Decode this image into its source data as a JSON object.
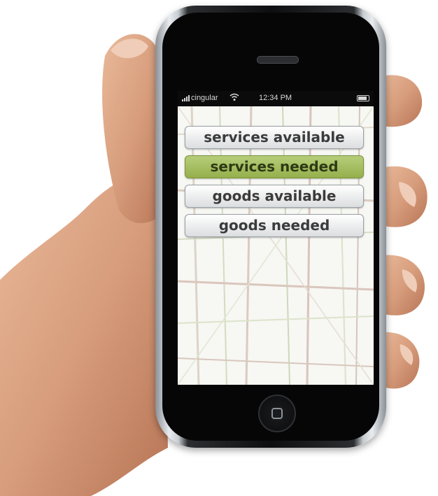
{
  "statusbar": {
    "carrier": "cingular",
    "time": "12:34 PM"
  },
  "menu": {
    "items": [
      {
        "label": "services available",
        "active": false
      },
      {
        "label": "services needed",
        "active": true
      },
      {
        "label": "goods available",
        "active": false
      },
      {
        "label": "goods needed",
        "active": false
      }
    ]
  },
  "colors": {
    "active_button": "#a3bc5f",
    "button": "#e9eaec",
    "button_text": "#3b3b3b"
  }
}
